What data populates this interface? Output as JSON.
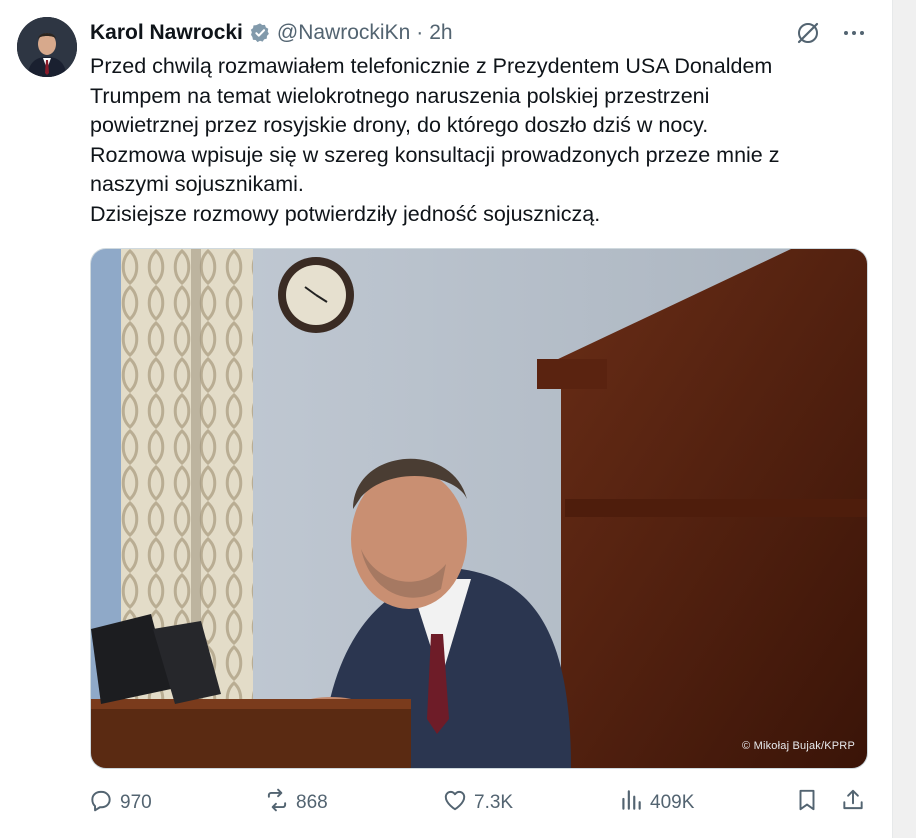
{
  "author": {
    "name": "Karol Nawrocki",
    "handle": "@NawrockiKn",
    "separator": "·",
    "time": "2h"
  },
  "tweet": {
    "lines": [
      "Przed chwilą rozmawiałem telefonicznie z Prezydentem USA Donaldem",
      "Trumpem na temat wielokrotnego naruszenia polskiej przestrzeni",
      "powietrznej przez rosyjskie drony, do którego doszło dziś w nocy.",
      "Rozmowa wpisuje się w szereg konsultacji prowadzonych przeze mnie z",
      "naszymi sojusznikami.",
      "Dzisiejsze rozmowy potwierdziły jedność sojuszniczą."
    ]
  },
  "media": {
    "credit": "© Mikołaj Bujak/KPRP"
  },
  "actions": {
    "replies": "970",
    "reposts": "868",
    "likes": "7.3K",
    "views": "409K"
  },
  "colors": {
    "text": "#0f1419",
    "muted": "#536471",
    "verified": "#829aab"
  },
  "icons": [
    "verified-badge-icon",
    "grok-icon",
    "more-icon",
    "reply-icon",
    "repost-icon",
    "like-icon",
    "views-icon",
    "bookmark-icon",
    "share-icon"
  ]
}
